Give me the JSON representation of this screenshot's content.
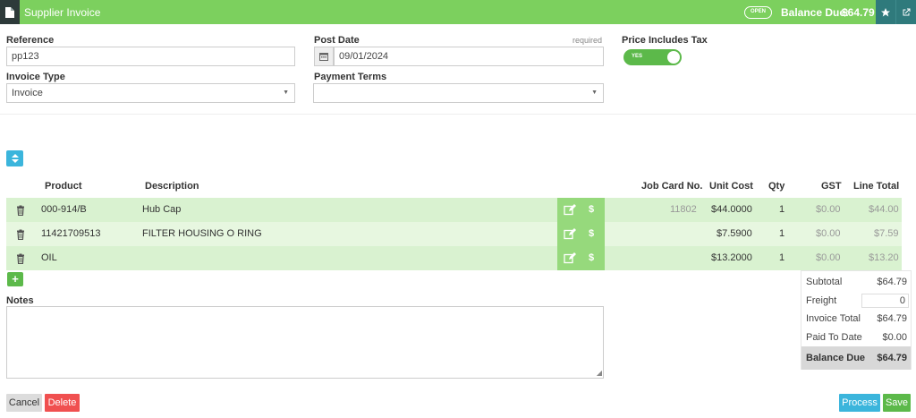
{
  "header": {
    "title": "Supplier Invoice",
    "status": "OPEN",
    "balance_label": "Balance Due:",
    "balance_value": "$64.79",
    "icons": [
      "document-icon",
      "star-icon",
      "external-link-icon"
    ]
  },
  "form": {
    "reference": {
      "label": "Reference",
      "value": "pp123"
    },
    "post_date": {
      "label": "Post Date",
      "required": "required",
      "value": "09/01/2024"
    },
    "price_includes_tax": {
      "label": "Price Includes Tax",
      "toggle": "YES"
    },
    "invoice_type": {
      "label": "Invoice Type",
      "value": "Invoice"
    },
    "payment_terms": {
      "label": "Payment Terms",
      "value": ""
    }
  },
  "table": {
    "headers": {
      "product": "Product",
      "description": "Description",
      "job_card": "Job Card No.",
      "unit_cost": "Unit Cost",
      "qty": "Qty",
      "gst": "GST",
      "line_total": "Line Total"
    },
    "rows": [
      {
        "product": "000-914/B",
        "description": "Hub Cap",
        "job_card": "11802",
        "unit_cost": "$44.0000",
        "qty": "1",
        "gst": "$0.00",
        "line_total": "$44.00",
        "dollar": "$"
      },
      {
        "product": "11421709513",
        "description": "FILTER HOUSING O RING",
        "job_card": "",
        "unit_cost": "$7.5900",
        "qty": "1",
        "gst": "$0.00",
        "line_total": "$7.59",
        "dollar": "$"
      },
      {
        "product": "OIL",
        "description": "",
        "job_card": "",
        "unit_cost": "$13.2000",
        "qty": "1",
        "gst": "$0.00",
        "line_total": "$13.20",
        "dollar": "$"
      }
    ],
    "add_label": "+"
  },
  "notes": {
    "label": "Notes",
    "value": ""
  },
  "totals": {
    "subtotal": {
      "label": "Subtotal",
      "value": "$64.79"
    },
    "freight": {
      "label": "Freight",
      "value": "0"
    },
    "invoice_total": {
      "label": "Invoice Total",
      "value": "$64.79"
    },
    "paid_to_date": {
      "label": "Paid To Date",
      "value": "$0.00"
    },
    "balance_due": {
      "label": "Balance Due",
      "value": "$64.79"
    }
  },
  "footer": {
    "cancel": "Cancel",
    "delete": "Delete",
    "process": "Process",
    "save": "Save"
  },
  "colors": {
    "brand_green": "#7cd05e",
    "teal": "#2f7a7c",
    "info_blue": "#3bb5dc",
    "danger_red": "#f05050",
    "row_green": "#d9f2d0"
  }
}
